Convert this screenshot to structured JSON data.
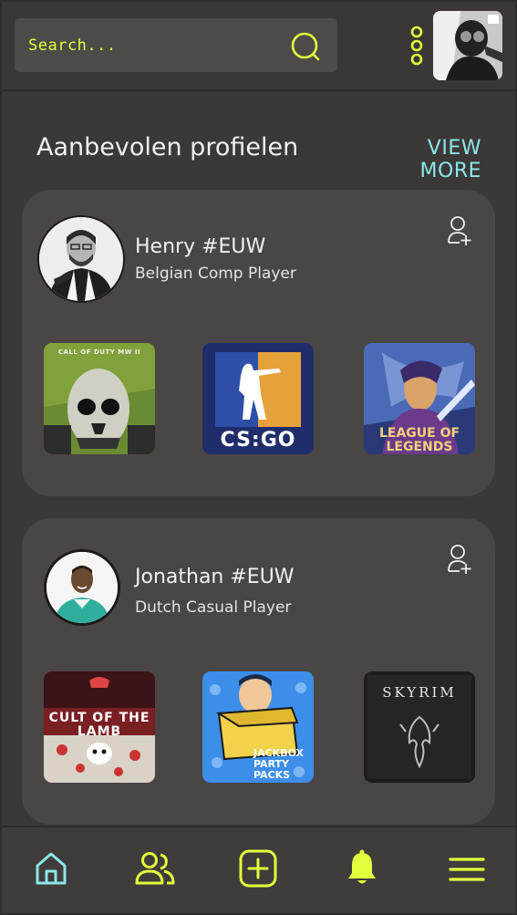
{
  "header": {
    "search_placeholder": "Search..."
  },
  "section": {
    "title": "Aanbevolen profielen",
    "view_more": "VIEW MORE"
  },
  "profiles": [
    {
      "name": "Henry #EUW",
      "description": "Belgian Comp Player",
      "games": [
        "CALL OF DUTY MW II",
        "CS:GO",
        "LEAGUE OF LEGENDS"
      ]
    },
    {
      "name": "Jonathan #EUW",
      "description": "Dutch Casual Player",
      "games": [
        "CULT OF THE LAMB",
        "JACKBOX PARTY PACKS",
        "SKYRIM"
      ]
    }
  ],
  "colors": {
    "accent": "#e4ff3c",
    "link": "#8ae8ea",
    "nav_active": "#8ae8ea",
    "card": "#4a4645",
    "background": "#3b3837"
  },
  "nav": {
    "items": [
      "home-icon",
      "friends-icon",
      "add-icon",
      "bell-icon",
      "menu-icon"
    ]
  }
}
